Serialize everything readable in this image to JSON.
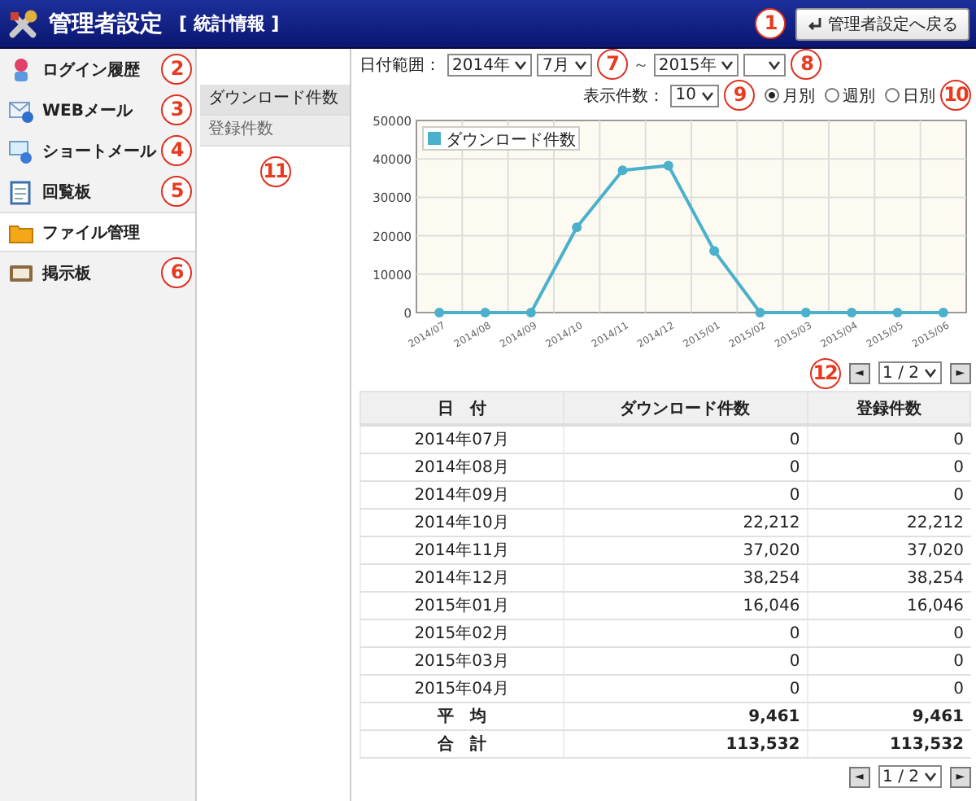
{
  "header": {
    "title": "管理者設定",
    "subtitle": "[ 統計情報 ]",
    "back_button": "管理者設定へ戻る"
  },
  "sidebar": {
    "items": [
      {
        "label": "ログイン履歴",
        "selected": false
      },
      {
        "label": "WEBメール",
        "selected": false
      },
      {
        "label": "ショートメール",
        "selected": false
      },
      {
        "label": "回覧板",
        "selected": false
      },
      {
        "label": "ファイル管理",
        "selected": true
      },
      {
        "label": "掲示板",
        "selected": false
      }
    ]
  },
  "submenu": {
    "items": [
      {
        "label": "ダウンロード件数",
        "selected": true
      },
      {
        "label": "登録件数",
        "selected": false
      }
    ]
  },
  "filters": {
    "range_label": "日付範囲：",
    "from_year": "2014年",
    "from_month": "7月",
    "separator": "～",
    "to_year": "2015年",
    "count_label": "表示件数：",
    "count": "10",
    "periods": [
      {
        "label": "月別",
        "selected": true
      },
      {
        "label": "週別",
        "selected": false
      },
      {
        "label": "日別",
        "selected": false
      }
    ]
  },
  "chart_data": {
    "type": "line",
    "grid": true,
    "x": [
      "2014/07",
      "2014/08",
      "2014/09",
      "2014/10",
      "2014/11",
      "2014/12",
      "2015/01",
      "2015/02",
      "2015/03",
      "2015/04",
      "2015/05",
      "2015/06"
    ],
    "series": [
      {
        "name": "ダウンロード件数",
        "color": "#4bb0cc",
        "marker": "circle",
        "values": [
          0,
          0,
          0,
          22212,
          37020,
          38254,
          16046,
          0,
          0,
          0,
          0,
          0
        ]
      }
    ],
    "ylim": [
      0,
      50000
    ],
    "yticks": [
      0,
      10000,
      20000,
      30000,
      40000,
      50000
    ]
  },
  "pager_top": {
    "prev": "◄",
    "page": "1 / 2",
    "next": "►"
  },
  "table": {
    "columns": [
      "日　付",
      "ダウンロード件数",
      "登録件数"
    ],
    "rows": [
      [
        "2014年07月",
        "0",
        "0"
      ],
      [
        "2014年08月",
        "0",
        "0"
      ],
      [
        "2014年09月",
        "0",
        "0"
      ],
      [
        "2014年10月",
        "22,212",
        "22,212"
      ],
      [
        "2014年11月",
        "37,020",
        "37,020"
      ],
      [
        "2014年12月",
        "38,254",
        "38,254"
      ],
      [
        "2015年01月",
        "16,046",
        "16,046"
      ],
      [
        "2015年02月",
        "0",
        "0"
      ],
      [
        "2015年03月",
        "0",
        "0"
      ],
      [
        "2015年04月",
        "0",
        "0"
      ]
    ],
    "summary": [
      [
        "平　均",
        "9,461",
        "9,461"
      ],
      [
        "合　計",
        "113,532",
        "113,532"
      ]
    ]
  },
  "pager_bottom": {
    "prev": "◄",
    "page": "1 / 2",
    "next": "►"
  },
  "callouts": [
    "1",
    "2",
    "3",
    "4",
    "5",
    "6",
    "7",
    "8",
    "9",
    "10",
    "11",
    "12"
  ]
}
